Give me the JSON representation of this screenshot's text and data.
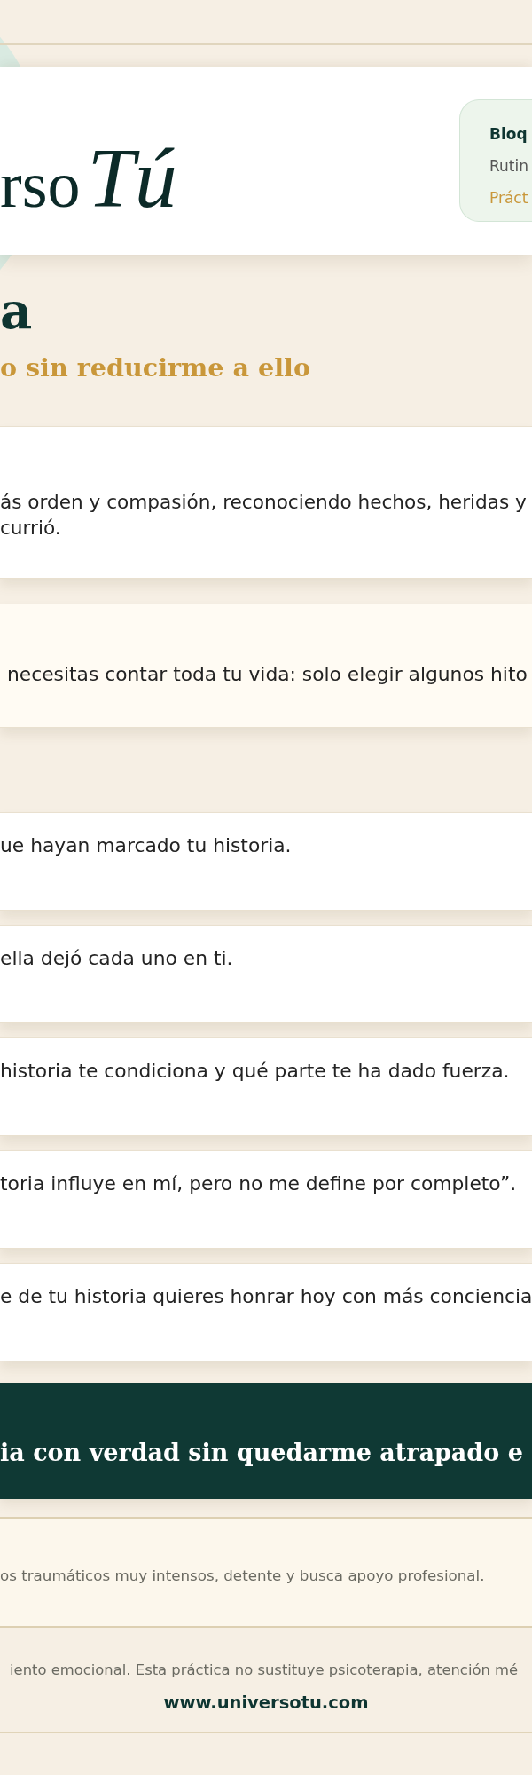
{
  "header": {
    "logo": {
      "wordmark": "rso",
      "script": "Tú"
    },
    "block_info": {
      "title": "Bloq",
      "routine": "Rutin",
      "category": "Práct"
    }
  },
  "page_title": "a",
  "page_subtitle": "o sin reducirme a ello",
  "intro": {
    "text": "ás orden y compasión, reconociendo hechos, heridas y currió."
  },
  "tip": {
    "text": "necesitas contar toda tu vida: solo elegir algunos hito"
  },
  "steps": [
    {
      "text": "ue hayan marcado tu historia."
    },
    {
      "text": "ella dejó cada uno en ti."
    },
    {
      "text": "historia te condiciona y qué parte te ha dado fuerza."
    },
    {
      "text": "toria influye en mí, pero no me define por completo”."
    },
    {
      "text": "e de tu historia quieres honrar hoy con más conciencia"
    }
  ],
  "closing_banner": {
    "text": "ia con verdad sin quedarme atrapado e"
  },
  "notice": {
    "text": "os traumáticos muy intensos, detente y busca apoyo profesional."
  },
  "footer": {
    "disclaimer": "iento emocional. Esta práctica no sustituye psicoterapia, atención mé",
    "website": "www.universotu.com"
  }
}
